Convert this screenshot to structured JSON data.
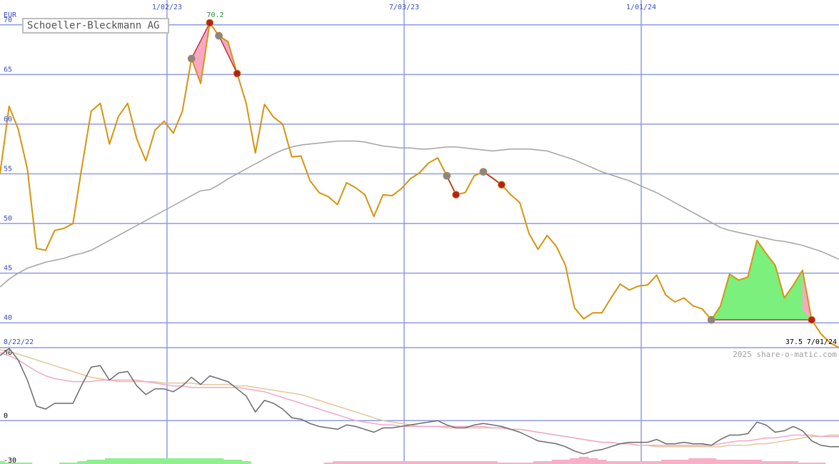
{
  "colors": {
    "grid": "#8f9ae8",
    "price": "#d4950f",
    "ma_long": "#a3a3a3",
    "gain_fill": "#7cf07c",
    "loss_fill": "#f7a8c4",
    "signal_low": "#b52020",
    "signal_high": "#888888",
    "osc_main": "#6b6b6b",
    "osc_fast": "#f0a8c8",
    "osc_slow": "#e2c79a",
    "volume_pos": "#8ff08f",
    "volume_neg": "#f7b0c8"
  },
  "title": "Schoeller-Bleckmann AG",
  "credit": "2025 share-o-matic.com",
  "chart_data": {
    "type": "line",
    "title": "Schoeller-Bleckmann AG",
    "ylabel": "EUR",
    "ylim": [
      37.5,
      72.5
    ],
    "yticks": [
      40,
      45,
      50,
      55,
      60,
      65,
      70
    ],
    "x_range": [
      "8/22/22",
      "7/01/24"
    ],
    "x_start_label": "8/22/22",
    "x_end_label": "7/01/24",
    "x_ticks": [
      {
        "label": "1/02/23",
        "index": 18
      },
      {
        "label": "7/03/23",
        "index": 44
      },
      {
        "label": "1/01/24",
        "index": 70
      }
    ],
    "max_label": "70.2",
    "max_label_index": 24,
    "last_label": "37.5",
    "grid": true,
    "series": [
      {
        "name": "price",
        "values": [
          55.0,
          61.8,
          59.5,
          55.5,
          47.5,
          47.3,
          49.3,
          49.5,
          50.0,
          55.8,
          61.3,
          62.1,
          58.0,
          60.8,
          62.1,
          58.5,
          56.3,
          59.4,
          60.3,
          59.1,
          61.3,
          66.6,
          64.1,
          70.2,
          68.9,
          68.3,
          65.1,
          62.1,
          57.1,
          62.0,
          60.7,
          60.0,
          56.7,
          56.8,
          54.3,
          53.1,
          52.7,
          51.9,
          54.1,
          53.6,
          52.9,
          50.7,
          52.9,
          52.8,
          53.5,
          54.5,
          55.1,
          56.1,
          56.6,
          54.8,
          52.9,
          53.1,
          54.8,
          55.2,
          54.6,
          53.9,
          52.9,
          52.1,
          49.0,
          47.4,
          48.8,
          47.7,
          45.8,
          41.5,
          40.4,
          41.0,
          41.0,
          42.5,
          43.9,
          43.3,
          43.7,
          43.8,
          44.8,
          42.8,
          42.1,
          42.5,
          41.7,
          41.4,
          40.3,
          41.7,
          44.9,
          44.3,
          44.6,
          48.3,
          47.0,
          45.8,
          42.5,
          43.8,
          45.3,
          40.3,
          38.9,
          38.0,
          37.5
        ]
      },
      {
        "name": "moving-average",
        "values": [
          43.6,
          44.4,
          45.0,
          45.5,
          45.8,
          46.1,
          46.3,
          46.5,
          46.8,
          47.0,
          47.3,
          47.8,
          48.3,
          48.8,
          49.3,
          49.8,
          50.3,
          50.8,
          51.3,
          51.8,
          52.3,
          52.8,
          53.3,
          53.4,
          53.9,
          54.5,
          55.0,
          55.5,
          56.0,
          56.5,
          57.0,
          57.4,
          57.7,
          57.9,
          58.0,
          58.1,
          58.2,
          58.3,
          58.3,
          58.3,
          58.2,
          58.0,
          57.8,
          57.7,
          57.6,
          57.6,
          57.5,
          57.5,
          57.6,
          57.7,
          57.7,
          57.6,
          57.5,
          57.4,
          57.3,
          57.4,
          57.5,
          57.5,
          57.5,
          57.4,
          57.3,
          57.0,
          56.7,
          56.4,
          56.0,
          55.6,
          55.2,
          54.9,
          54.6,
          54.3,
          53.9,
          53.5,
          53.1,
          52.6,
          52.1,
          51.6,
          51.1,
          50.6,
          50.1,
          49.6,
          49.3,
          49.1,
          48.9,
          48.7,
          48.5,
          48.3,
          48.2,
          48.0,
          47.8,
          47.5,
          47.2,
          46.8,
          46.4
        ]
      }
    ],
    "signal_segments": [
      {
        "from": 21,
        "to": 23,
        "result": "loss"
      },
      {
        "from": 24,
        "to": 26,
        "result": "loss"
      },
      {
        "from": 49,
        "to": 50,
        "result": "loss"
      },
      {
        "from": 53,
        "to": 55,
        "result": "loss"
      },
      {
        "from": 78,
        "to": 89,
        "result": "gain"
      }
    ],
    "oscillator": {
      "yticks": [
        50,
        0,
        -30
      ],
      "ylim": [
        -30,
        50
      ],
      "series": [
        {
          "name": "oscillator",
          "values": [
            45,
            50,
            42,
            28,
            10,
            8,
            12,
            12,
            12,
            25,
            37,
            38,
            28,
            33,
            34,
            24,
            18,
            22,
            22,
            20,
            24,
            30,
            25,
            31,
            29,
            27,
            22,
            17,
            6,
            14,
            12,
            8,
            2,
            1,
            -2,
            -4,
            -5,
            -6,
            -3,
            -4,
            -6,
            -8,
            -5,
            -5,
            -4,
            -3,
            -2,
            -1,
            0,
            -3,
            -5,
            -5,
            -3,
            -2,
            -3,
            -4,
            -6,
            -8,
            -11,
            -14,
            -15,
            -16,
            -18,
            -21,
            -23,
            -21,
            -20,
            -18,
            -16,
            -15,
            -15,
            -15,
            -13,
            -16,
            -16,
            -15,
            -16,
            -16,
            -17,
            -13,
            -10,
            -10,
            -9,
            -1,
            -3,
            -8,
            -7,
            -4,
            -7,
            -14,
            -17,
            -18,
            -18
          ]
        },
        {
          "name": "signal-fast",
          "values": [
            47,
            45,
            42,
            38,
            34,
            31,
            29,
            28,
            27,
            27,
            27,
            28,
            28,
            28,
            28,
            28,
            27,
            26,
            25,
            24,
            24,
            23,
            23,
            23,
            23,
            23,
            23,
            22,
            21,
            20,
            18,
            16,
            14,
            12,
            10,
            8,
            6,
            4,
            2,
            0,
            -1,
            -2,
            -3,
            -3,
            -4,
            -4,
            -4,
            -4,
            -4,
            -4,
            -4,
            -4,
            -4,
            -4,
            -5,
            -5,
            -6,
            -6,
            -7,
            -8,
            -9,
            -10,
            -11,
            -12,
            -13,
            -14,
            -15,
            -15,
            -16,
            -16,
            -17,
            -17,
            -17,
            -17,
            -17,
            -17,
            -17,
            -17,
            -17,
            -16,
            -15,
            -14,
            -14,
            -13,
            -12,
            -12,
            -11,
            -10,
            -10,
            -10,
            -11,
            -11,
            -11
          ]
        },
        {
          "name": "signal-slow",
          "values": [
            49,
            48,
            46,
            44,
            42,
            40,
            38,
            36,
            34,
            32,
            30,
            29,
            28,
            27,
            27,
            27,
            27,
            27,
            26,
            26,
            26,
            26,
            25,
            25,
            25,
            25,
            24,
            24,
            23,
            22,
            21,
            20,
            19,
            18,
            16,
            14,
            12,
            10,
            8,
            6,
            4,
            2,
            0,
            -1,
            -2,
            -3,
            -4,
            -4,
            -4,
            -5,
            -5,
            -5,
            -5,
            -5,
            -5,
            -5,
            -6,
            -6,
            -7,
            -8,
            -9,
            -10,
            -11,
            -12,
            -13,
            -14,
            -15,
            -15,
            -16,
            -16,
            -17,
            -17,
            -18,
            -18,
            -18,
            -18,
            -18,
            -18,
            -18,
            -18,
            -17,
            -17,
            -17,
            -16,
            -16,
            -15,
            -14,
            -13,
            -12,
            -11,
            -11,
            -10,
            -10
          ]
        }
      ]
    },
    "volume_histogram": {
      "ylim": [
        -30,
        50
      ],
      "values": [
        -28,
        -29,
        -29,
        -29,
        -30,
        -30,
        -30,
        -29,
        -29,
        -28,
        -27,
        -27,
        -26,
        -26,
        -26,
        -26,
        -26,
        -26,
        -26,
        -26,
        -26,
        -26,
        -26,
        -26,
        -26,
        -27,
        -27,
        -28,
        -29,
        -30,
        -30,
        -30,
        -30,
        -30,
        -30,
        -30,
        -29,
        -28,
        -28,
        -28,
        -28,
        -28,
        -28,
        -28,
        -28,
        -28,
        -28,
        -28,
        -28,
        -28,
        -28,
        -28,
        -28,
        -28,
        -28,
        -29,
        -29,
        -29,
        -29,
        -28,
        -28,
        -27,
        -27,
        -26,
        -25,
        -26,
        -27,
        -28,
        -28,
        -28,
        -28,
        -28,
        -28,
        -27,
        -27,
        -27,
        -26,
        -26,
        -26,
        -27,
        -27,
        -27,
        -27,
        -27,
        -28,
        -28,
        -28,
        -28,
        -29,
        -29,
        -29,
        -30,
        -30
      ],
      "signs": [
        1,
        1,
        1,
        1,
        0,
        0,
        0,
        1,
        1,
        1,
        1,
        1,
        1,
        1,
        1,
        1,
        1,
        1,
        1,
        1,
        1,
        1,
        1,
        1,
        1,
        1,
        1,
        1,
        0,
        0,
        0,
        0,
        0,
        0,
        0,
        0,
        -1,
        -1,
        -1,
        -1,
        -1,
        -1,
        -1,
        -1,
        -1,
        -1,
        -1,
        -1,
        -1,
        -1,
        -1,
        -1,
        -1,
        -1,
        -1,
        -1,
        -1,
        -1,
        -1,
        -1,
        -1,
        -1,
        -1,
        -1,
        -1,
        -1,
        -1,
        -1,
        -1,
        -1,
        -1,
        -1,
        -1,
        -1,
        -1,
        -1,
        -1,
        -1,
        -1,
        -1,
        -1,
        -1,
        -1,
        -1,
        -1,
        -1,
        -1,
        -1,
        -1,
        -1,
        -1,
        0,
        0
      ]
    }
  }
}
